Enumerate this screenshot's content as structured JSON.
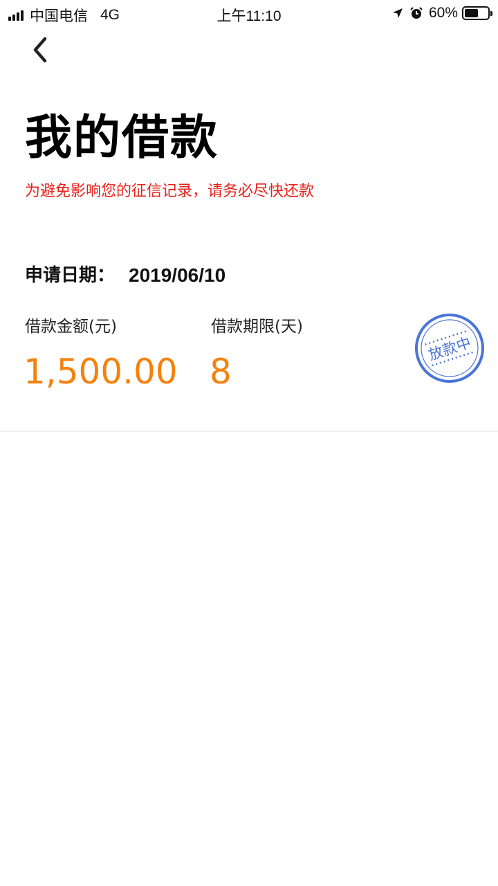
{
  "status_bar": {
    "carrier": "中国电信",
    "network": "4G",
    "time": "上午11:10",
    "battery": "60%",
    "battery_level": 0.6
  },
  "header": {
    "back_icon": "chevron-left-icon",
    "title": "我的借款",
    "warning": "为避免影响您的征信记录，请务必尽快还款"
  },
  "loan": {
    "apply_date_label": "申请日期：",
    "apply_date": "2019/06/10",
    "amount_label": "借款金额(元)",
    "amount": "1,500.00",
    "term_label": "借款期限(天)",
    "term": "8",
    "status_stamp": "放款中"
  },
  "colors": {
    "warning": "#e8201a",
    "value": "#f5820d",
    "stamp": "#4a74d6"
  }
}
